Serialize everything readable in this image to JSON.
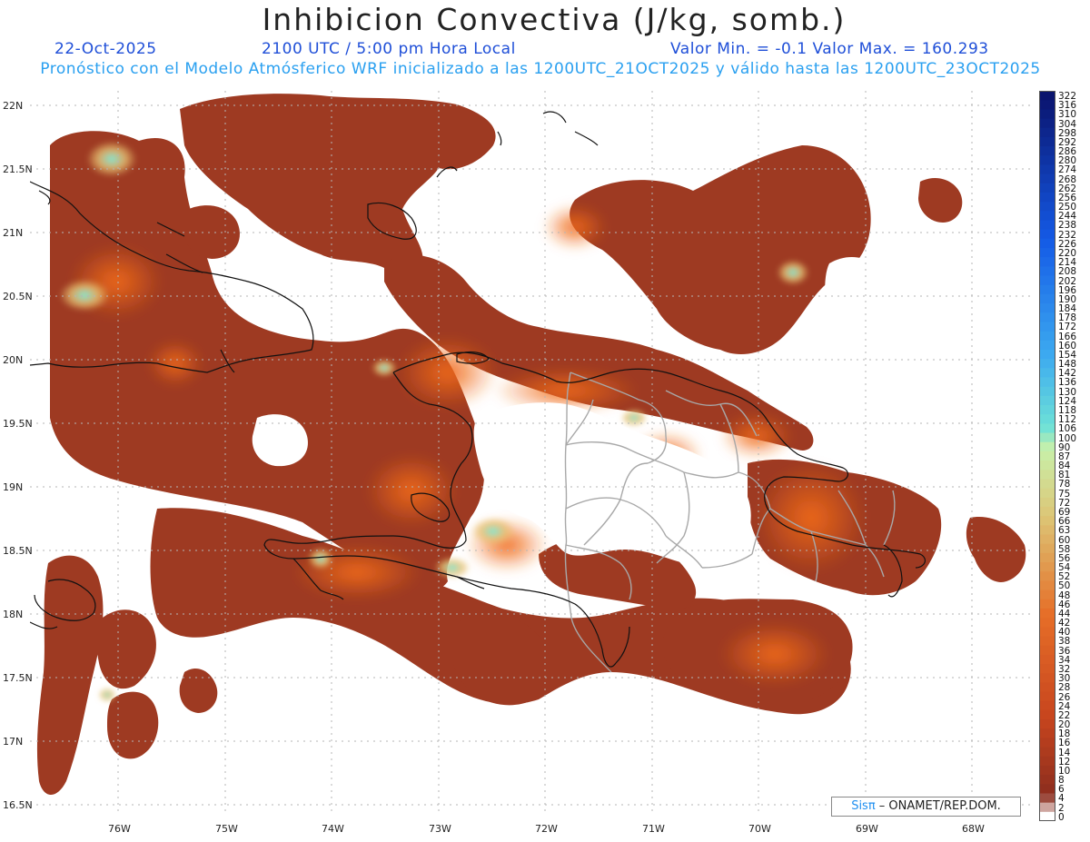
{
  "header": {
    "title": "Inhibicion Convectiva (J/kg, somb.)",
    "date": "22-Oct-2025",
    "time": "2100 UTC / 5:00 pm Hora Local",
    "minmax": "Valor Min. = -0.1  Valor Max. = 160.293",
    "subtitle": "Pronóstico con el Modelo Atmósferico WRF inicializado a las 1200UTC_21OCT2025 y válido hasta las  1200UTC_23OCT2025"
  },
  "map": {
    "lat_labels": [
      "22N",
      "21.5N",
      "21N",
      "20.5N",
      "20N",
      "19.5N",
      "19N",
      "18.5N",
      "18N",
      "17.5N",
      "17N",
      "16.5N"
    ],
    "lon_labels": [
      "76W",
      "75W",
      "74W",
      "73W",
      "72W",
      "71W",
      "70W",
      "69W",
      "68W"
    ],
    "colors": {
      "base": "#9a3523",
      "mid": "#c4451e",
      "bright": "#e85a14",
      "yellow": "#e0c070",
      "cyan": "#66e0d0",
      "coast": "#111111",
      "borders": "#a0a0a0",
      "grid": "#b5b5b5"
    }
  },
  "colorbar": {
    "labels": [
      "322",
      "316",
      "310",
      "304",
      "298",
      "292",
      "286",
      "280",
      "274",
      "268",
      "262",
      "256",
      "250",
      "244",
      "238",
      "232",
      "226",
      "220",
      "214",
      "208",
      "202",
      "196",
      "190",
      "184",
      "178",
      "172",
      "166",
      "160",
      "154",
      "148",
      "142",
      "136",
      "130",
      "124",
      "118",
      "112",
      "106",
      "100",
      "90",
      "87",
      "84",
      "81",
      "78",
      "75",
      "72",
      "69",
      "66",
      "63",
      "60",
      "58",
      "56",
      "54",
      "52",
      "50",
      "48",
      "46",
      "44",
      "42",
      "40",
      "38",
      "36",
      "34",
      "32",
      "30",
      "28",
      "26",
      "24",
      "22",
      "20",
      "18",
      "16",
      "14",
      "12",
      "10",
      "8",
      "6",
      "4",
      "2",
      "0"
    ]
  },
  "credit": {
    "sis": "Sisπ",
    "org": " – ONAMET/REP.DOM."
  }
}
